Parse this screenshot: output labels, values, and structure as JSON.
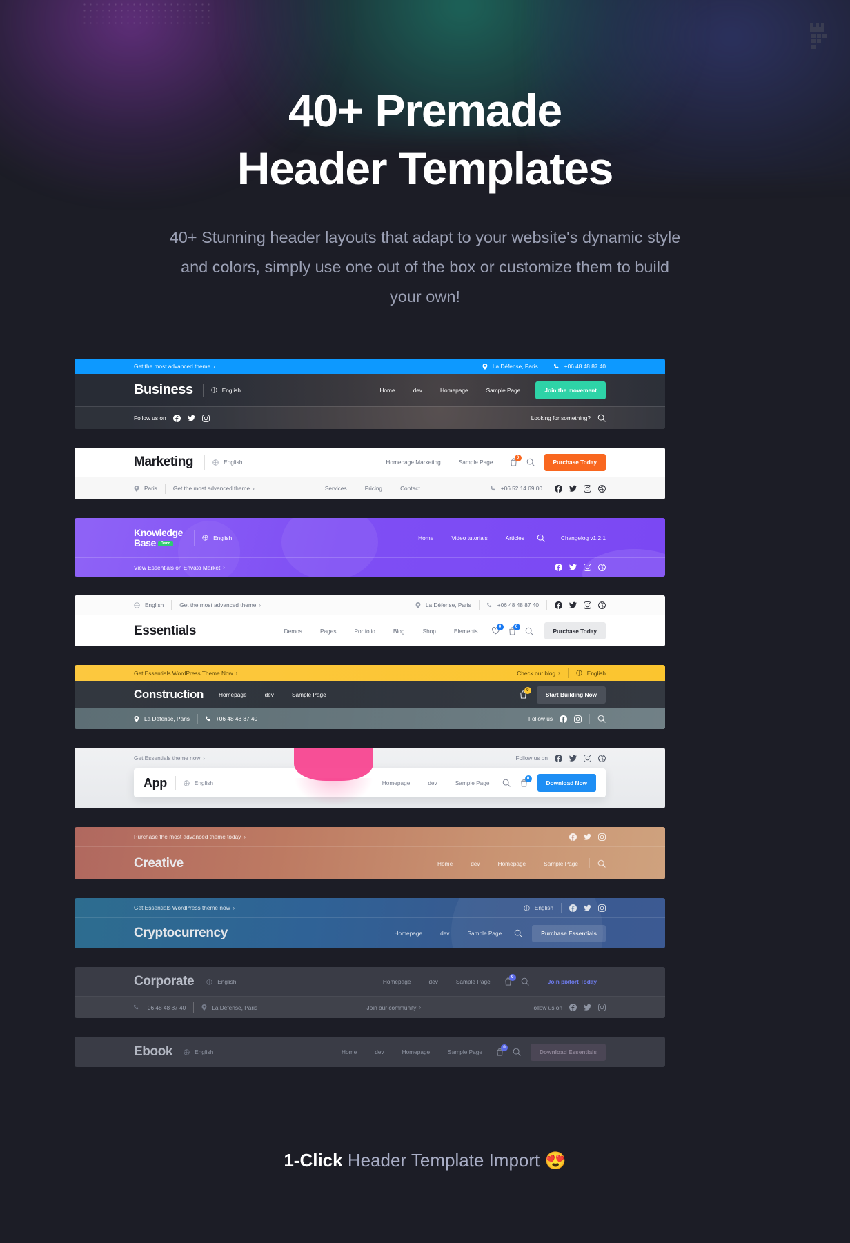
{
  "hero": {
    "logo_icon": "pixfort-castle-logo",
    "title_line1": "40+ Premade",
    "title_line2": "Header Templates",
    "subtitle": "40+ Stunning header layouts that adapt to your website's dynamic style and colors, simply use one out of the box or customize them to build your own!"
  },
  "caption": {
    "strong": "1-Click",
    "rest": " Header Template Import ",
    "emoji": "😍"
  },
  "colors": {
    "page_bg": "#1c1d26",
    "business_blue": "#0d99ff",
    "business_cta": "#2ed3a7",
    "marketing_orange": "#f9671f",
    "kb_purple": "#7e4ef4",
    "construction_yellow": "#fbc52f",
    "app_blue": "#1e8ef4",
    "essentials_badge": "#1778f2",
    "caption_text": "#a9aec6"
  },
  "headers": [
    {
      "id": "business",
      "logo": "Business",
      "language": "English",
      "topbar_promo": "Get the most advanced theme",
      "location": "La Défense, Paris",
      "phone": "+06 48 48 87 40",
      "nav": [
        "Home",
        "dev",
        "Homepage",
        "Sample Page"
      ],
      "cta": "Join the movement",
      "follow_label": "Follow us on",
      "search_label": "Looking for something?",
      "socials": [
        "facebook",
        "twitter",
        "instagram"
      ]
    },
    {
      "id": "marketing",
      "logo": "Marketing",
      "language": "English",
      "nav": [
        "Homepage Marketing",
        "Sample Page"
      ],
      "cart_count": "0",
      "cta": "Purchase Today",
      "city": "Paris",
      "promo": "Get the most advanced theme",
      "nav2": [
        "Services",
        "Pricing",
        "Contact"
      ],
      "phone": "+06 52 14 69 00",
      "socials": [
        "facebook",
        "twitter",
        "instagram",
        "dribbble"
      ]
    },
    {
      "id": "knowledge-base",
      "logo_line1": "Knowledge",
      "logo_line2": "Base",
      "logo_pill": "Demo",
      "language": "English",
      "nav": [
        "Home",
        "Video tutorials",
        "Articles"
      ],
      "changelog": "Changelog v1.2.1",
      "bottom_link": "View Essentials on Envato Market",
      "socials": [
        "facebook",
        "twitter",
        "instagram",
        "dribbble"
      ]
    },
    {
      "id": "essentials",
      "logo": "Essentials",
      "language": "English",
      "promo": "Get the most advanced theme",
      "location": "La Défense, Paris",
      "phone": "+06 48 48 87 40",
      "socials": [
        "facebook",
        "twitter",
        "instagram",
        "dribbble"
      ],
      "nav": [
        "Demos",
        "Pages",
        "Portfolio",
        "Blog",
        "Shop",
        "Elements"
      ],
      "wishlist_count": "0",
      "cart_count": "0",
      "cta": "Purchase Today"
    },
    {
      "id": "construction",
      "logo": "Construction",
      "topbar_promo": "Get Essentials WordPress Theme Now",
      "blog_link": "Check our blog",
      "language": "English",
      "nav": [
        "Homepage",
        "dev",
        "Sample Page"
      ],
      "cart_count": "0",
      "cta": "Start Building Now",
      "location": "La Défense, Paris",
      "phone": "+06 48 48 87 40",
      "follow_label": "Follow us",
      "socials": [
        "facebook",
        "instagram"
      ]
    },
    {
      "id": "app",
      "logo": "App",
      "language": "English",
      "topbar_promo": "Get Essentials theme now",
      "follow_label": "Follow us on",
      "socials": [
        "facebook",
        "twitter",
        "instagram",
        "dribbble"
      ],
      "nav": [
        "Homepage",
        "dev",
        "Sample Page"
      ],
      "cart_count": "0",
      "cta": "Download Now"
    },
    {
      "id": "creative",
      "logo": "Creative",
      "topbar_promo": "Purchase the most advanced theme today",
      "socials": [
        "facebook",
        "twitter",
        "instagram"
      ],
      "nav": [
        "Home",
        "dev",
        "Homepage",
        "Sample Page"
      ]
    },
    {
      "id": "cryptocurrency",
      "logo": "Cryptocurrency",
      "topbar_promo": "Get Essentials WordPress theme now",
      "language": "English",
      "socials": [
        "facebook",
        "twitter",
        "instagram"
      ],
      "nav": [
        "Homepage",
        "dev",
        "Sample Page"
      ],
      "cta": "Purchase Essentials"
    },
    {
      "id": "corporate",
      "logo": "Corporate",
      "language": "English",
      "nav": [
        "Homepage",
        "dev",
        "Sample Page"
      ],
      "cart_count": "0",
      "cta": "Join pixfort Today",
      "phone": "+06 48 48 87 40",
      "location": "La Défense, Paris",
      "community_link": "Join our community",
      "follow_label": "Follow us on",
      "socials": [
        "facebook",
        "twitter",
        "instagram"
      ]
    },
    {
      "id": "ebook",
      "logo": "Ebook",
      "language": "English",
      "nav": [
        "Home",
        "dev",
        "Homepage",
        "Sample Page"
      ],
      "cart_count": "0",
      "cta": "Download Essentials"
    }
  ]
}
